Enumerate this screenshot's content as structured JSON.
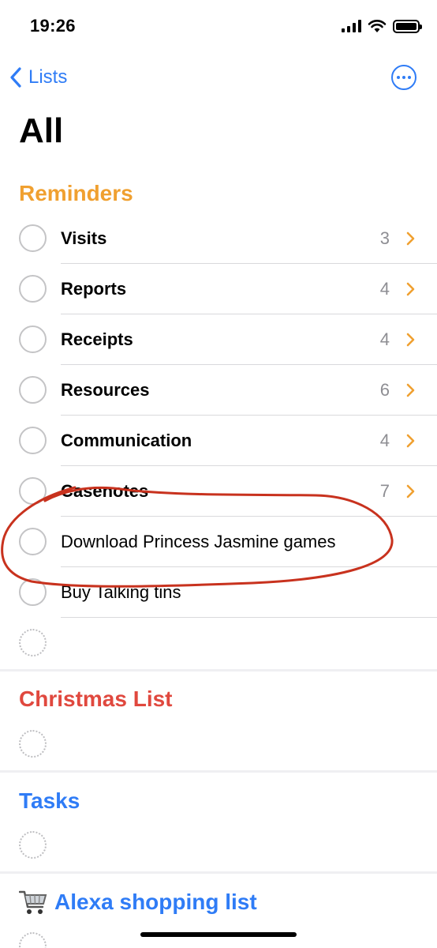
{
  "status_bar": {
    "time": "19:26"
  },
  "nav": {
    "back_label": "Lists"
  },
  "page_title": "All",
  "colors": {
    "accent_blue": "#2f7cf6",
    "reminders_orange": "#f0a030",
    "christmas_red": "#e0483e",
    "annotation_red": "#c8321e"
  },
  "sections": {
    "reminders": {
      "title": "Reminders",
      "items": [
        {
          "label": "Visits",
          "count": "3"
        },
        {
          "label": "Reports",
          "count": "4"
        },
        {
          "label": "Receipts",
          "count": "4"
        },
        {
          "label": "Resources",
          "count": "6"
        },
        {
          "label": "Communication",
          "count": "4"
        },
        {
          "label": "Casenotes",
          "count": "7"
        },
        {
          "label": "Download Princess Jasmine games"
        },
        {
          "label": "Buy Talking tins"
        }
      ]
    },
    "christmas": {
      "title": "Christmas List"
    },
    "tasks": {
      "title": "Tasks"
    },
    "alexa": {
      "title": "Alexa shopping list",
      "icon": "shopping-cart-icon"
    }
  }
}
